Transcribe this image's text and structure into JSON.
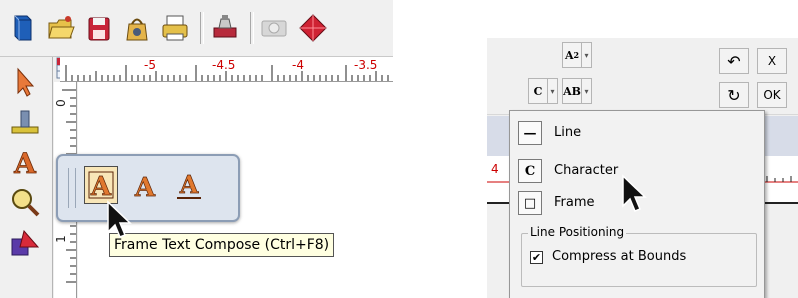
{
  "left_panel": {
    "toolbar": {
      "icons": [
        "book-icon",
        "open-folder-icon",
        "save-disk-icon",
        "bag-icon",
        "print-icon",
        "stamp-icon",
        "camera-icon",
        "diamond-icon"
      ]
    },
    "ruler_h": {
      "labels": [
        "-5",
        "-4.5",
        "-4",
        "-3.5"
      ]
    },
    "ruler_v": {
      "labels": [
        "0",
        "1"
      ]
    },
    "tools": [
      "pointer-icon",
      "stamp-tool-icon",
      "text-tool-icon",
      "zoom-icon",
      "shapes-icon"
    ],
    "flyout": {
      "icons": [
        "frame-text-compose-icon",
        "text-icon",
        "underline-text-icon"
      ]
    },
    "tooltip": "Frame Text Compose (Ctrl+F8)"
  },
  "right_panel": {
    "toolbar": {
      "superscript_label": "A",
      "superscript_mark": "2",
      "case_label": "AB",
      "c_label": "C",
      "undo_glyph": "↶",
      "close_label": "X",
      "redo_glyph": "↻",
      "ok_label": "OK"
    },
    "ruler_tick": "4",
    "menu": {
      "items": [
        {
          "icon_glyph": "—",
          "label": "Line"
        },
        {
          "icon_glyph": "C",
          "label": "Character"
        },
        {
          "icon_glyph": "□",
          "label": "Frame"
        }
      ],
      "group_title": "Line Positioning",
      "checkbox": {
        "checked": true,
        "mark": "✔",
        "label": "Compress at Bounds"
      }
    }
  },
  "colors": {
    "toolbar_bg": "#f0f0f0",
    "flyout_bg": "#dde4ee",
    "tooltip_bg": "#ffffe1",
    "ruler_red": "#cc0000",
    "band_blue": "#d7dce8"
  }
}
